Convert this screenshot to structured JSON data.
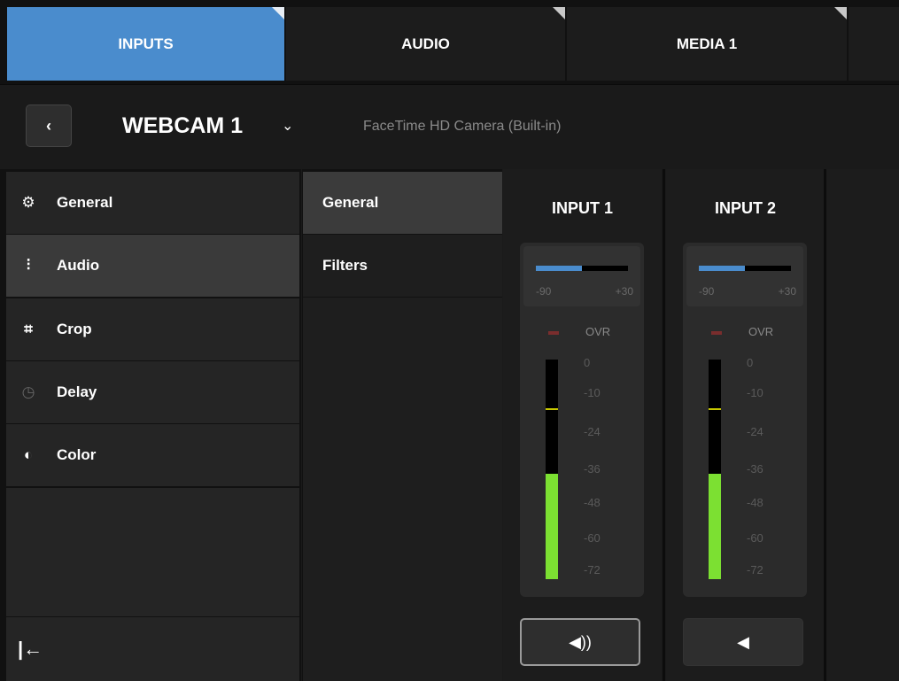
{
  "tabs": [
    {
      "label": "INPUTS",
      "active": true
    },
    {
      "label": "AUDIO",
      "active": false
    },
    {
      "label": "MEDIA 1",
      "active": false
    }
  ],
  "header": {
    "back_icon": "chevron-left-icon",
    "back_glyph": "‹",
    "title": "WEBCAM 1",
    "dropdown_glyph": "⌄",
    "subtitle": "FaceTime HD Camera (Built-in)"
  },
  "left_nav": {
    "items": [
      {
        "label": "General",
        "icon": "gear-icon",
        "glyph": "⚙",
        "active": false
      },
      {
        "label": "Audio",
        "icon": "audio-mixer-icon",
        "glyph": "⫶",
        "active": true
      },
      {
        "label": "Crop",
        "icon": "crop-icon",
        "glyph": "⌗",
        "active": false
      },
      {
        "label": "Delay",
        "icon": "clock-icon",
        "glyph": "◷",
        "active": false
      },
      {
        "label": "Color",
        "icon": "color-drop-icon",
        "glyph": "◐",
        "active": false
      }
    ],
    "collapse_icon": "collapse-left-icon",
    "collapse_glyph": "|←"
  },
  "sub_nav": {
    "items": [
      {
        "label": "General",
        "active": true
      },
      {
        "label": "Filters",
        "active": false
      }
    ]
  },
  "channels": [
    {
      "title": "INPUT 1",
      "slider_value_fraction": 0.5,
      "range_min": "-90",
      "range_max": "+30",
      "ovr_label": "OVR",
      "scale": [
        "0",
        "-10",
        "-24",
        "-36",
        "-48",
        "-60",
        "-72"
      ],
      "meter_level_fraction": 0.48,
      "peak_mark_fraction": 0.77,
      "mute_icon": "speaker-on-icon",
      "mute_glyph": "◀))",
      "muted": false
    },
    {
      "title": "INPUT 2",
      "slider_value_fraction": 0.5,
      "range_min": "-90",
      "range_max": "+30",
      "ovr_label": "OVR",
      "scale": [
        "0",
        "-10",
        "-24",
        "-36",
        "-48",
        "-60",
        "-72"
      ],
      "meter_level_fraction": 0.48,
      "peak_mark_fraction": 0.77,
      "mute_icon": "speaker-off-icon",
      "mute_glyph": "◀",
      "muted": true
    }
  ],
  "colors": {
    "accent": "#4a8ccd",
    "meter_green": "#7ce032",
    "peak_yellow": "#c8c800",
    "ovr_red": "#7a2d2d"
  }
}
